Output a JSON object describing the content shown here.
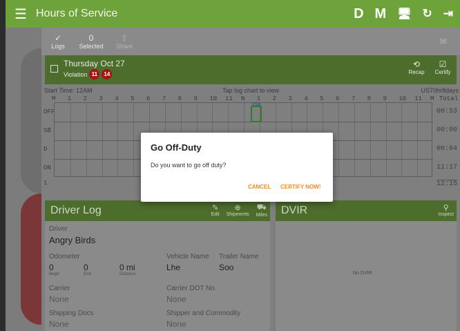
{
  "appbar": {
    "title": "Hours of Service",
    "right_labels": [
      "D",
      "M"
    ],
    "icons": [
      "menu-icon",
      "driver-icon",
      "mode-icon",
      "desktop-icon",
      "refresh-icon",
      "logout-icon"
    ]
  },
  "toolbar": {
    "logs_label": "Logs",
    "selected_count": "0",
    "selected_label": "Selected",
    "share_label": "Share"
  },
  "day": {
    "date": "Thursday Oct 27",
    "violation_label": "Violation",
    "badges": [
      "11",
      "14"
    ],
    "recap_label": "Recap",
    "certify_label": "Certify"
  },
  "graph": {
    "start_time": "Start Time: 12AM",
    "hint": "Tap log chart to view",
    "cycle": "US70hr8days",
    "hours": [
      "M",
      "1",
      "2",
      "3",
      "4",
      "5",
      "6",
      "7",
      "8",
      "9",
      "10",
      "11",
      "N",
      "1",
      "2",
      "3",
      "4",
      "5",
      "6",
      "7",
      "8",
      "9",
      "10",
      "11",
      "M"
    ],
    "total_label": "Total",
    "rows": [
      {
        "label": "OFF",
        "total": "00:53"
      },
      {
        "label": "SB",
        "total": "00:00"
      },
      {
        "label": "D",
        "total": "00:04"
      },
      {
        "label": "ON",
        "total": "11:17"
      }
    ],
    "grand_total": "12:15",
    "bottom_left": "1"
  },
  "driver_log": {
    "title": "Driver Log",
    "edit_label": "Edit",
    "shipments_label": "Shipments",
    "miles_label": "Miles",
    "driver_label": "Driver",
    "driver_value": "Angry Birds",
    "odometer_label": "Odometer",
    "odo_begin": "0",
    "odo_begin_sub": "Begin",
    "odo_end": "0",
    "odo_end_sub": "End",
    "distance": "0 mi",
    "distance_sub": "Distance",
    "vehicle_label": "Vehicle Name",
    "vehicle_value": "Lhe",
    "trailer_label": "Trailer Name",
    "trailer_value": "Soo",
    "carrier_label": "Carrier",
    "carrier_value": "None",
    "dot_label": "Carrier DOT No.",
    "dot_value": "None",
    "shipping_label": "Shipping Docs",
    "shipping_value": "None",
    "commodity_label": "Shipper and Commodity",
    "commodity_value": "None"
  },
  "dvir": {
    "title": "DVIR",
    "inspect_label": "Inspect",
    "empty": "No DVIR"
  },
  "dialog": {
    "title": "Go Off-Duty",
    "message": "Do you want to go off duty?",
    "cancel": "CANCEL",
    "certify": "CERTIFY NOW!"
  }
}
